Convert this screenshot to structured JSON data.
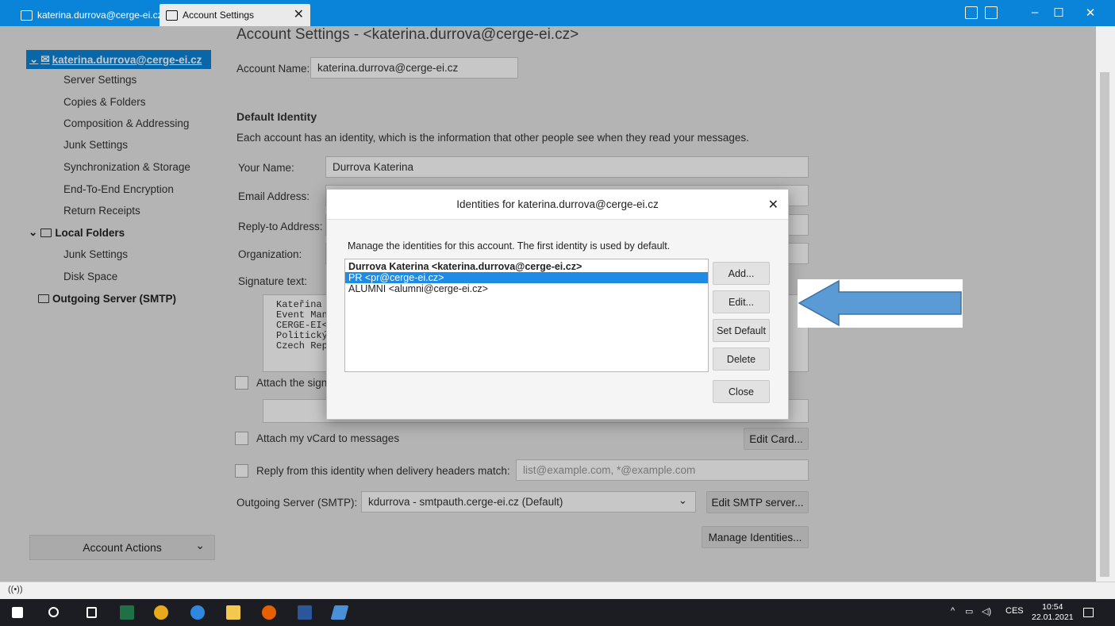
{
  "tabs": [
    {
      "label": "katerina.durrova@cerge-ei.cz",
      "icon": "mail-icon"
    },
    {
      "label": "Account Settings",
      "icon": "settings-tab-icon",
      "close": "✕"
    }
  ],
  "window_controls": {
    "minimize": "–",
    "maximize": "☐",
    "close": "✕"
  },
  "sidebar": {
    "account": "katerina.durrova@cerge-ei.cz",
    "account_items": [
      "Server Settings",
      "Copies & Folders",
      "Composition & Addressing",
      "Junk Settings",
      "Synchronization & Storage",
      "End-To-End Encryption",
      "Return Receipts"
    ],
    "local_folders": "Local Folders",
    "local_items": [
      "Junk Settings",
      "Disk Space"
    ],
    "outgoing": "Outgoing Server (SMTP)",
    "account_actions": "Account Actions",
    "account_actions_arrow": "⌄"
  },
  "content": {
    "title": "Account Settings - <katerina.durrova@cerge-ei.cz>",
    "account_name_label": "Account Name:",
    "account_name_value": "katerina.durrova@cerge-ei.cz",
    "default_identity": "Default Identity",
    "identity_desc": "Each account has an identity, which is the information that other people see when they read your messages.",
    "your_name_label": "Your Name:",
    "your_name_value": "Durrova Katerina",
    "email_label": "Email Address:",
    "reply_to_label": "Reply-to Address:",
    "organization_label": "Organization:",
    "signature_label": "Signature text:",
    "signature_lines": [
      "Kateřina D",
      "Event Mana",
      "CERGE-EI<b",
      "Politickýc",
      "Czech Repu"
    ],
    "attach_sig_label": "Attach the sign",
    "vcard_label": "Attach my vCard to messages",
    "edit_card": "Edit Card...",
    "reply_from_label": "Reply from this identity when delivery headers match:",
    "reply_from_placeholder": "list@example.com, *@example.com",
    "smtp_label": "Outgoing Server (SMTP):",
    "smtp_value": "kdurrova - smtpauth.cerge-ei.cz (Default)",
    "edit_smtp": "Edit SMTP server...",
    "manage_identities": "Manage Identities..."
  },
  "dialog": {
    "title": "Identities for katerina.durrova@cerge-ei.cz",
    "close": "✕",
    "description": "Manage the identities for this account. The first identity is used by default.",
    "identities": [
      "Durrova Katerina <katerina.durrova@cerge-ei.cz>",
      "PR <pr@cerge-ei.cz>",
      "ALUMNI <alumni@cerge-ei.cz>"
    ],
    "selected_index": 1,
    "buttons": [
      "Add...",
      "Edit...",
      "Set Default",
      "Delete",
      "Close"
    ]
  },
  "taskbar": {
    "language": "CES",
    "time": "10:54",
    "date": "22.01.2021"
  },
  "colors": {
    "accent": "#0a84d9",
    "selection": "#1e8be6",
    "arrow": "#5b9bd5",
    "taskbar": "#1b1d23"
  }
}
